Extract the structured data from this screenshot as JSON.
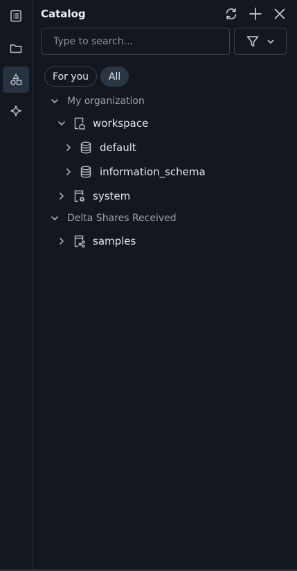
{
  "header": {
    "title": "Catalog",
    "icons": [
      "refresh-icon",
      "plus-icon",
      "close-icon"
    ]
  },
  "rail": {
    "items": [
      "notebook-icon",
      "folder-icon",
      "shapes-icon",
      "sparkle-icon"
    ],
    "active": "shapes-icon"
  },
  "search": {
    "placeholder": "Type to search...",
    "value": ""
  },
  "filter": {
    "icons": [
      "filter-icon",
      "chevron-down-icon"
    ]
  },
  "pills": [
    {
      "label": "For you",
      "selected": false
    },
    {
      "label": "All",
      "selected": true
    }
  ],
  "tree": {
    "group_my_org": "My organization",
    "workspace": "workspace",
    "default": "default",
    "information_schema": "information_schema",
    "system": "system",
    "group_delta": "Delta Shares Received",
    "samples": "samples"
  },
  "colors": {
    "background": "#13171e",
    "active_rail": "#273241",
    "selected_pill": "#2b3644",
    "border": "#3a424e"
  }
}
